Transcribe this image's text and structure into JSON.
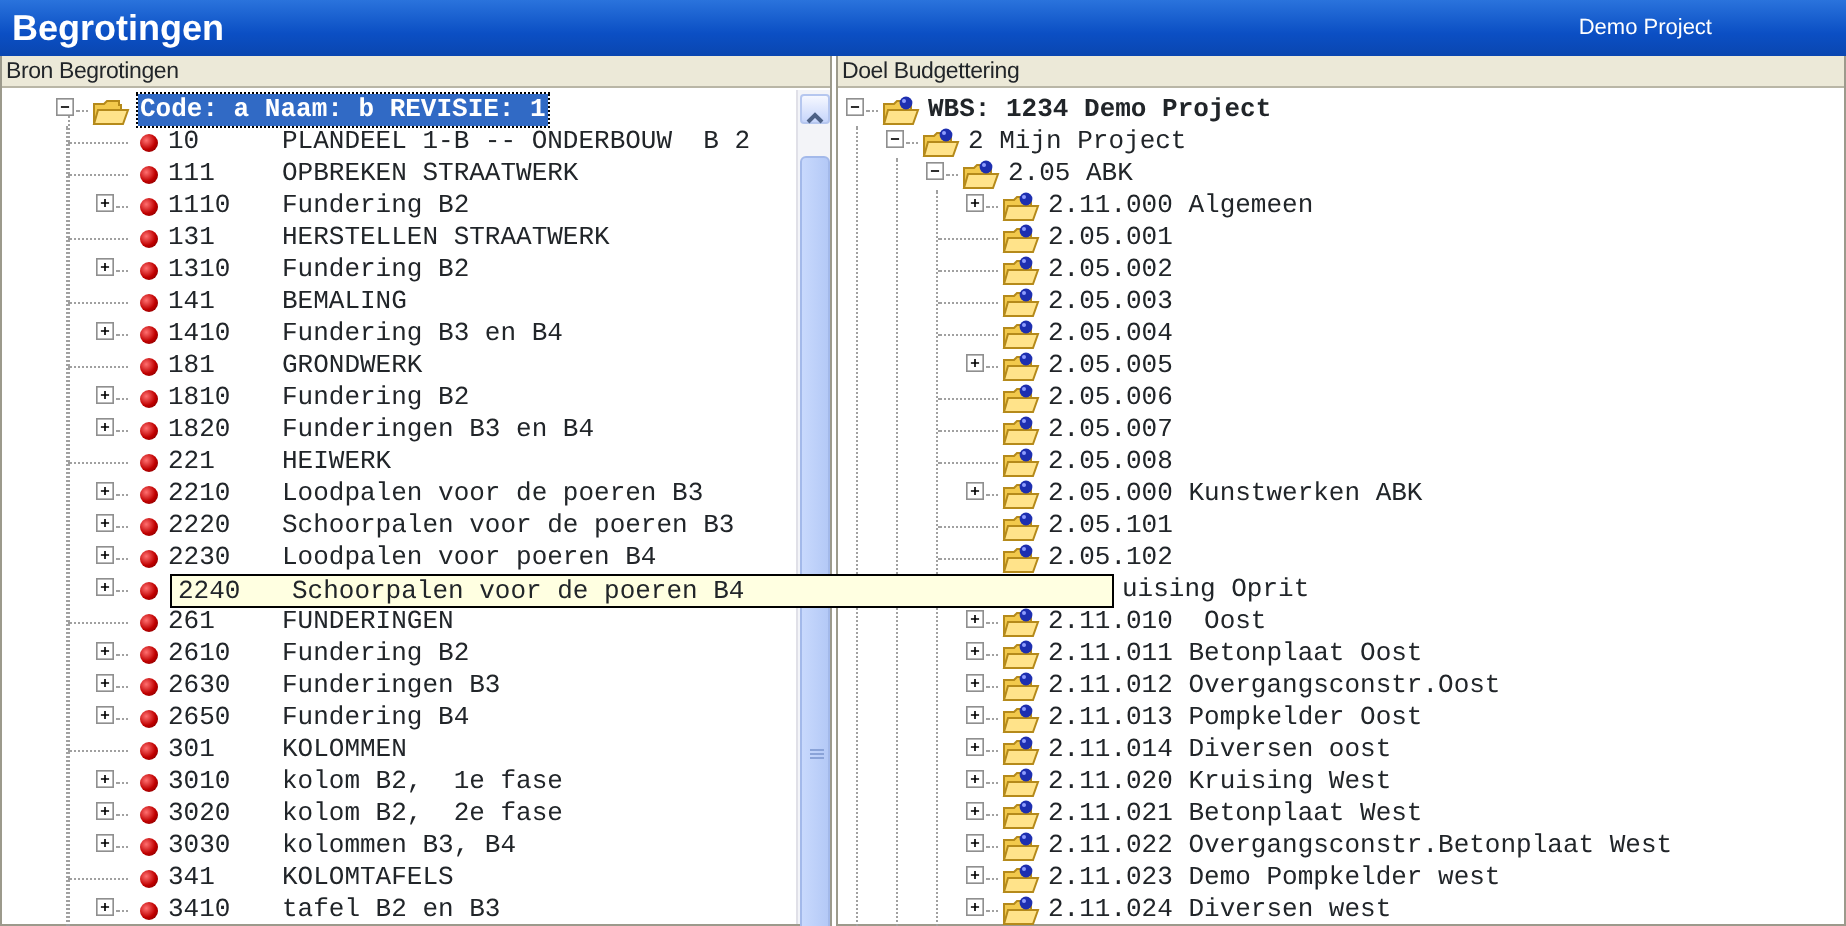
{
  "window": {
    "title": "Begrotingen",
    "project": "Demo Project"
  },
  "source": {
    "header": "Bron Begrotingen",
    "root": {
      "label": "Code: a Naam: b REVISIE: 1",
      "has_children": true,
      "expanded": true,
      "selected": true,
      "children": [
        {
          "code": "10",
          "name": "PLANDEEL 1-B -- ONDERBOUW  B 2",
          "has_children": false,
          "hovered": false
        },
        {
          "code": "111",
          "name": "OPBREKEN STRAATWERK",
          "has_children": false,
          "hovered": false
        },
        {
          "code": "1110",
          "name": "Fundering B2",
          "has_children": true,
          "expanded": false,
          "hovered": false
        },
        {
          "code": "131",
          "name": "HERSTELLEN STRAATWERK",
          "has_children": false,
          "hovered": false
        },
        {
          "code": "1310",
          "name": "Fundering B2",
          "has_children": true,
          "expanded": false,
          "hovered": false
        },
        {
          "code": "141",
          "name": "BEMALING",
          "has_children": false,
          "hovered": false
        },
        {
          "code": "1410",
          "name": "Fundering B3 en B4",
          "has_children": true,
          "expanded": false,
          "hovered": false
        },
        {
          "code": "181",
          "name": "GRONDWERK",
          "has_children": false,
          "hovered": false
        },
        {
          "code": "1810",
          "name": "Fundering B2",
          "has_children": true,
          "expanded": false,
          "hovered": false
        },
        {
          "code": "1820",
          "name": "Funderingen B3 en B4",
          "has_children": true,
          "expanded": false,
          "hovered": false
        },
        {
          "code": "221",
          "name": "HEIWERK",
          "has_children": false,
          "hovered": false
        },
        {
          "code": "2210",
          "name": "Loodpalen voor de poeren B3",
          "has_children": true,
          "expanded": false,
          "hovered": false
        },
        {
          "code": "2220",
          "name": "Schoorpalen voor de poeren B3",
          "has_children": true,
          "expanded": false,
          "hovered": false
        },
        {
          "code": "2230",
          "name": "Loodpalen voor poeren B4",
          "has_children": true,
          "expanded": false,
          "hovered": false
        },
        {
          "code": "2240",
          "name": "Schoorpalen voor de poeren B4",
          "has_children": true,
          "expanded": false,
          "hovered": true
        },
        {
          "code": "261",
          "name": "FUNDERINGEN",
          "has_children": false,
          "hovered": false
        },
        {
          "code": "2610",
          "name": "Fundering B2",
          "has_children": true,
          "expanded": false,
          "hovered": false
        },
        {
          "code": "2630",
          "name": "Funderingen B3",
          "has_children": true,
          "expanded": false,
          "hovered": false
        },
        {
          "code": "2650",
          "name": "Fundering B4",
          "has_children": true,
          "expanded": false,
          "hovered": false
        },
        {
          "code": "301",
          "name": "KOLOMMEN",
          "has_children": false,
          "hovered": false
        },
        {
          "code": "3010",
          "name": "kolom B2,  1e fase",
          "has_children": true,
          "expanded": false,
          "hovered": false
        },
        {
          "code": "3020",
          "name": "kolom B2,  2e fase",
          "has_children": true,
          "expanded": false,
          "hovered": false
        },
        {
          "code": "3030",
          "name": "kolommen B3, B4",
          "has_children": true,
          "expanded": false,
          "hovered": false
        },
        {
          "code": "341",
          "name": "KOLOMTAFELS",
          "has_children": false,
          "hovered": false
        },
        {
          "code": "3410",
          "name": "tafel B2 en B3",
          "has_children": true,
          "expanded": false,
          "hovered": false
        }
      ]
    }
  },
  "target": {
    "header": "Doel Budgettering",
    "root": {
      "label": "WBS: 1234 Demo Project",
      "has_children": true,
      "expanded": true,
      "kind": "node",
      "children": [
        {
          "label": "2 Mijn Project",
          "has_children": true,
          "expanded": true,
          "kind": "node",
          "children": [
            {
              "label": "2.05 ABK",
              "has_children": true,
              "expanded": true,
              "kind": "node",
              "children": [
                {
                  "label": "2.11.000 Algemeen",
                  "has_children": true,
                  "expanded": false,
                  "kind": "node"
                },
                {
                  "label": "2.05.001",
                  "has_children": false,
                  "kind": "node"
                },
                {
                  "label": "2.05.002",
                  "has_children": false,
                  "kind": "node"
                },
                {
                  "label": "2.05.003",
                  "has_children": false,
                  "kind": "node"
                },
                {
                  "label": "2.05.004",
                  "has_children": false,
                  "kind": "node"
                },
                {
                  "label": "2.05.005",
                  "has_children": true,
                  "expanded": false,
                  "kind": "node"
                },
                {
                  "label": "2.05.006",
                  "has_children": false,
                  "kind": "node"
                },
                {
                  "label": "2.05.007",
                  "has_children": false,
                  "kind": "node"
                },
                {
                  "label": "2.05.008",
                  "has_children": false,
                  "kind": "node"
                },
                {
                  "label": "2.05.000 Kunstwerken ABK",
                  "has_children": true,
                  "expanded": false,
                  "kind": "node"
                },
                {
                  "label": "2.05.101",
                  "has_children": false,
                  "kind": "node"
                },
                {
                  "label": "2.05.102",
                  "has_children": false,
                  "kind": "node"
                },
                {
                  "label": "uising Oprit",
                  "kind": "partial"
                },
                {
                  "label": "2.11.010  Oost",
                  "has_children": true,
                  "expanded": false,
                  "kind": "node"
                },
                {
                  "label": "2.11.011 Betonplaat Oost",
                  "has_children": true,
                  "expanded": false,
                  "kind": "node"
                },
                {
                  "label": "2.11.012 Overgangsconstr.Oost",
                  "has_children": true,
                  "expanded": false,
                  "kind": "node"
                },
                {
                  "label": "2.11.013 Pompkelder Oost",
                  "has_children": true,
                  "expanded": false,
                  "kind": "node"
                },
                {
                  "label": "2.11.014 Diversen oost",
                  "has_children": true,
                  "expanded": false,
                  "kind": "node"
                },
                {
                  "label": "2.11.020 Kruising West",
                  "has_children": true,
                  "expanded": false,
                  "kind": "node"
                },
                {
                  "label": "2.11.021 Betonplaat West",
                  "has_children": true,
                  "expanded": false,
                  "kind": "node"
                },
                {
                  "label": "2.11.022 Overgangsconstr.Betonplaat West",
                  "has_children": true,
                  "expanded": false,
                  "kind": "node"
                },
                {
                  "label": "2.11.023 Demo Pompkelder west",
                  "has_children": true,
                  "expanded": false,
                  "kind": "node"
                },
                {
                  "label": "2.11.024 Diversen west",
                  "has_children": true,
                  "expanded": false,
                  "kind": "node"
                }
              ]
            }
          ]
        }
      ]
    }
  }
}
